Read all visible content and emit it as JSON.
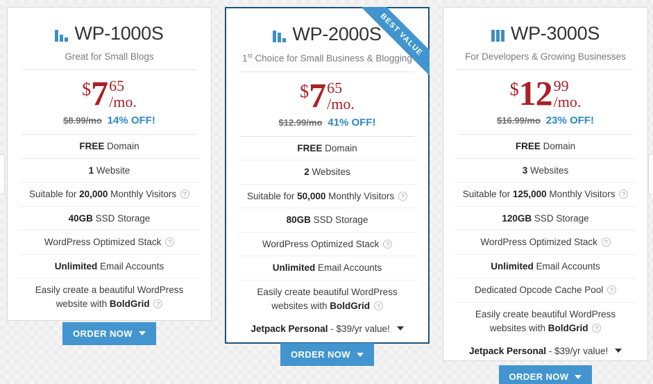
{
  "theme": {
    "accent_blue": "#4295ce",
    "price_red": "#ab2026",
    "discount_blue": "#2f87c4",
    "highlight_border": "#1b5478"
  },
  "ribbon": {
    "label": "BEST VALUE"
  },
  "plans": [
    {
      "name": "WP-1000S",
      "icon": "bar-chart-descending-icon",
      "tagline": "Great for Small Blogs",
      "tagline_sup": "",
      "tagline_rest": "Great for Small Blogs",
      "currency": "$",
      "amount": "7",
      "cents": "65",
      "period": "/mo.",
      "old_price": "$8.99/mo",
      "discount": "14% OFF!",
      "features": [
        {
          "bold_lead": "FREE",
          "text": " Domain",
          "help": false
        },
        {
          "bold_lead": "1",
          "text": " Website",
          "help": false
        },
        {
          "pre": "Suitable for ",
          "bold_lead": "20,000",
          "text": " Monthly Visitors",
          "help": true
        },
        {
          "bold_lead": "40GB",
          "text": " SSD Storage",
          "help": false
        },
        {
          "pre": "",
          "bold_lead": "",
          "text": "WordPress Optimized Stack",
          "help": true
        },
        {
          "bold_lead": "Unlimited",
          "text": " Email Accounts",
          "help": false
        },
        {
          "pre": "Easily create a beautiful WordPress website with ",
          "bold_lead": "BoldGrid",
          "text": "",
          "help": true
        }
      ],
      "jetpack": null,
      "cta": "ORDER NOW"
    },
    {
      "name": "WP-2000S",
      "icon": "bar-chart-descending-icon",
      "tagline": "1st Choice for Small Business & Blogging",
      "tagline_sup": "st",
      "tagline_rest": " Choice for Small Business & Blogging",
      "currency": "$",
      "amount": "7",
      "cents": "65",
      "period": "/mo.",
      "old_price": "$12.99/mo",
      "discount": "41% OFF!",
      "features": [
        {
          "bold_lead": "FREE",
          "text": " Domain",
          "help": false
        },
        {
          "bold_lead": "2",
          "text": " Websites",
          "help": false
        },
        {
          "pre": "Suitable for ",
          "bold_lead": "50,000",
          "text": " Monthly Visitors",
          "help": true
        },
        {
          "bold_lead": "80GB",
          "text": " SSD Storage",
          "help": false
        },
        {
          "pre": "",
          "bold_lead": "",
          "text": "WordPress Optimized Stack",
          "help": true
        },
        {
          "bold_lead": "Unlimited",
          "text": " Email Accounts",
          "help": false
        },
        {
          "pre": "Easily create beautiful WordPress websites with ",
          "bold_lead": "BoldGrid",
          "text": "",
          "help": true
        }
      ],
      "jetpack": {
        "name": "Jetpack Personal",
        "value": " - $39/yr value!"
      },
      "cta": "ORDER NOW"
    },
    {
      "name": "WP-3000S",
      "icon": "bar-chart-equal-icon",
      "tagline": "For Developers & Growing Businesses",
      "tagline_sup": "",
      "tagline_rest": "For Developers & Growing Businesses",
      "currency": "$",
      "amount": "12",
      "cents": "99",
      "period": "/mo.",
      "old_price": "$16.99/mo",
      "discount": "23% OFF!",
      "features": [
        {
          "bold_lead": "FREE",
          "text": " Domain",
          "help": false
        },
        {
          "bold_lead": "3",
          "text": " Websites",
          "help": false
        },
        {
          "pre": "Suitable for ",
          "bold_lead": "125,000",
          "text": " Monthly Visitors",
          "help": true
        },
        {
          "bold_lead": "120GB",
          "text": " SSD Storage",
          "help": false
        },
        {
          "pre": "",
          "bold_lead": "",
          "text": "WordPress Optimized Stack",
          "help": true
        },
        {
          "bold_lead": "Unlimited",
          "text": " Email Accounts",
          "help": false
        },
        {
          "pre": "",
          "bold_lead": "",
          "text": "Dedicated Opcode Cache Pool",
          "help": true
        },
        {
          "pre": "Easily create beautiful WordPress websites with ",
          "bold_lead": "BoldGrid",
          "text": "",
          "help": true
        }
      ],
      "jetpack": {
        "name": "Jetpack Personal",
        "value": " - $39/yr value!"
      },
      "cta": "ORDER NOW"
    }
  ]
}
